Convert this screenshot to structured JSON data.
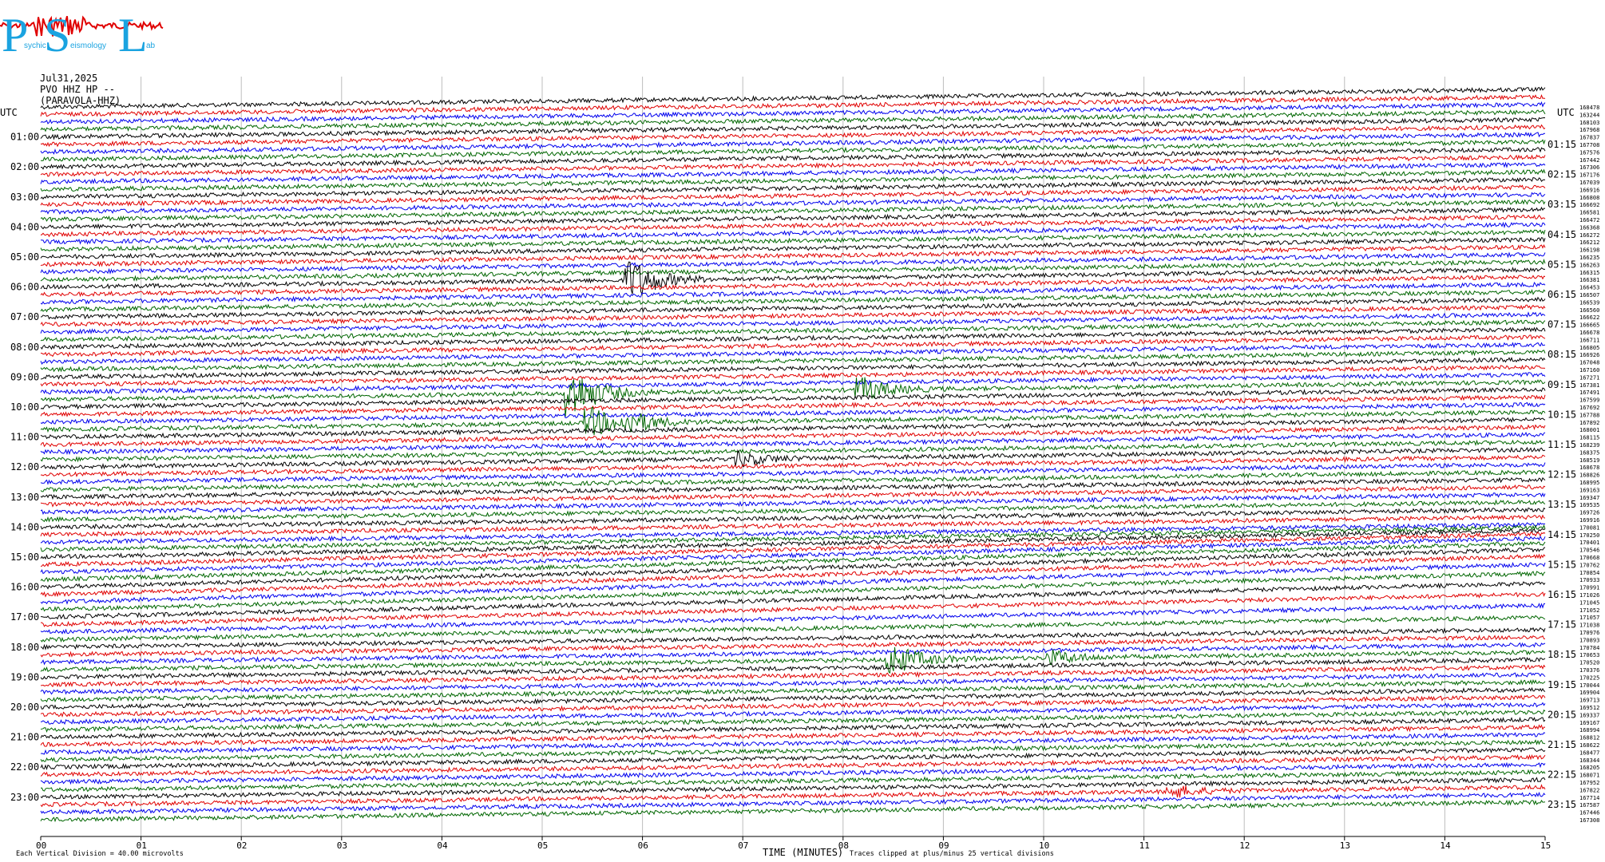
{
  "logo": {
    "letters": [
      "P",
      "S",
      "L"
    ],
    "small_words": [
      "sychic",
      "eismology",
      "ab"
    ],
    "colors": {
      "letters": "#1aa3e0",
      "wiggle": "#e00000"
    }
  },
  "header": {
    "date": "Jul31,2025",
    "station": "PVO HHZ HP --",
    "site": "(PARAVOLA-HHZ)"
  },
  "left_axis": {
    "corner_label": "UTC",
    "hour_labels": [
      "01:00",
      "02:00",
      "03:00",
      "04:00",
      "05:00",
      "06:00",
      "07:00",
      "08:00",
      "09:00",
      "10:00",
      "11:00",
      "12:00",
      "13:00",
      "14:00",
      "15:00",
      "16:00",
      "17:00",
      "18:00",
      "19:00",
      "20:00",
      "21:00",
      "22:00",
      "23:00"
    ]
  },
  "right_axis": {
    "corner_label": "UTC",
    "hour_labels": [
      "01:15",
      "02:15",
      "03:15",
      "04:15",
      "05:15",
      "06:15",
      "07:15",
      "08:15",
      "09:15",
      "10:15",
      "11:15",
      "12:15",
      "13:15",
      "14:15",
      "15:15",
      "16:15",
      "17:15",
      "18:15",
      "19:15",
      "20:15",
      "21:15",
      "22:15",
      "23:15"
    ],
    "trace_counts": [
      "168478",
      "163244",
      "168103",
      "167968",
      "167837",
      "167708",
      "167576",
      "167442",
      "167306",
      "167176",
      "167039",
      "166916",
      "166808",
      "166692",
      "166581",
      "166472",
      "166368",
      "166272",
      "166212",
      "166198",
      "166235",
      "166263",
      "166315",
      "166381",
      "166453",
      "166507",
      "166539",
      "166560",
      "166622",
      "166665",
      "166678",
      "166711",
      "166805",
      "166926",
      "167048",
      "167160",
      "167271",
      "167381",
      "167491",
      "167599",
      "167692",
      "167788",
      "167892",
      "168001",
      "168115",
      "168239",
      "168375",
      "168519",
      "168678",
      "168826",
      "168995",
      "169163",
      "169347",
      "169535",
      "169726",
      "169916",
      "170081",
      "170250",
      "170401",
      "170546",
      "170668",
      "170762",
      "170854",
      "170933",
      "170991",
      "171026",
      "171045",
      "171052",
      "171057",
      "171038",
      "170976",
      "170893",
      "170784",
      "170653",
      "170520",
      "170376",
      "170225",
      "170044",
      "169904",
      "169713",
      "169512",
      "169337",
      "169167",
      "168994",
      "168812",
      "168622",
      "168477",
      "168344",
      "168205",
      "168071",
      "167952",
      "167822",
      "167714",
      "167587",
      "167446",
      "167308"
    ]
  },
  "x_axis": {
    "tick_labels": [
      "00",
      "01",
      "02",
      "03",
      "04",
      "05",
      "06",
      "07",
      "08",
      "09",
      "10",
      "11",
      "12",
      "13",
      "14",
      "15"
    ],
    "title": "TIME (MINUTES)",
    "clip_note": "Traces clipped at plus/minus 25 vertical divisions"
  },
  "scale_note": "Each Vertical Division =   40.00 microvolts",
  "colors": {
    "trace_cycle": [
      "#000000",
      "#e00000",
      "#0000ee",
      "#006600"
    ],
    "grid": "#bdbdbd",
    "text": "#000000"
  },
  "chart_data": {
    "type": "line",
    "title": "Jul31,2025",
    "xlabel": "TIME (MINUTES)",
    "ylabel": "UTC",
    "xlim": [
      0,
      15
    ],
    "rows": 96,
    "row_duration_minutes": 15,
    "first_row_start_utc": "00:00",
    "color_cycle": [
      "black",
      "red",
      "blue",
      "green"
    ],
    "grid": true,
    "trend": "traces drift upward from left to right; strongest drift near 15:00-18:00",
    "events": [
      {
        "row_start_utc": "06:00",
        "minute": 5.9,
        "color": "red",
        "relative_amplitude": 3.2
      },
      {
        "row_start_utc": "09:45",
        "minute": 5.3,
        "color": "blue",
        "relative_amplitude": 3.8
      },
      {
        "row_start_utc": "09:45",
        "minute": 8.2,
        "color": "blue",
        "relative_amplitude": 1.8
      },
      {
        "row_start_utc": "10:45",
        "minute": 5.5,
        "color": "green",
        "relative_amplitude": 2.2
      },
      {
        "row_start_utc": "10:45",
        "minute": 5.9,
        "color": "green",
        "relative_amplitude": 1.2
      },
      {
        "row_start_utc": "12:00",
        "minute": 7.0,
        "color": "blue",
        "relative_amplitude": 1.0
      },
      {
        "row_start_utc": "18:45",
        "minute": 8.5,
        "color": "black",
        "relative_amplitude": 2.4
      },
      {
        "row_start_utc": "18:45",
        "minute": 10.1,
        "color": "black",
        "relative_amplitude": 1.0
      },
      {
        "row_start_utc": "23:15",
        "minute": 11.3,
        "color": "green",
        "relative_amplitude": 0.9
      }
    ]
  }
}
